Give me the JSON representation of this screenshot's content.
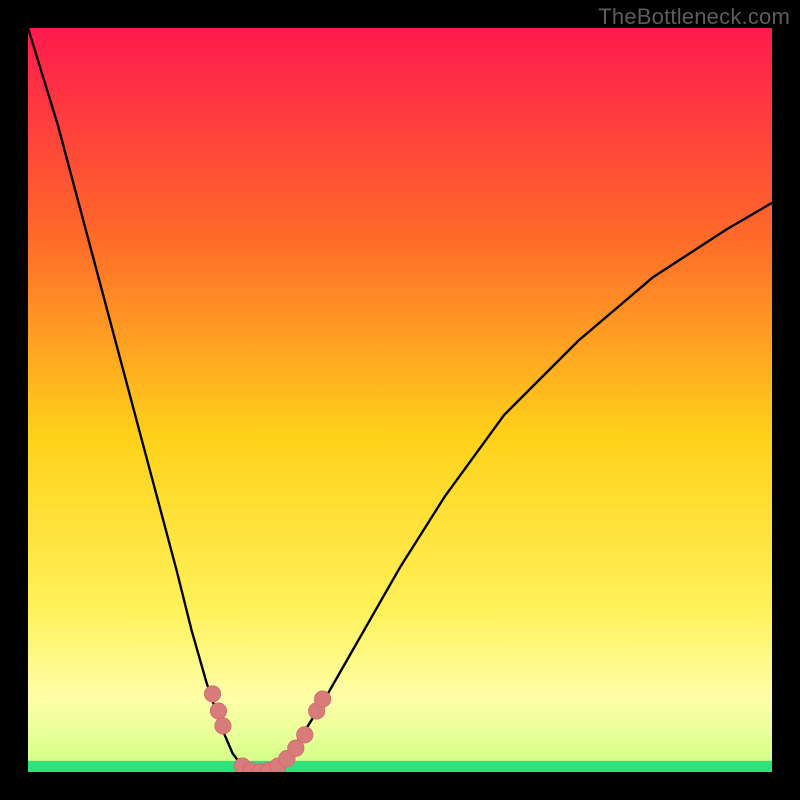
{
  "watermark": "TheBottleneck.com",
  "colors": {
    "frame": "#000000",
    "gradient_top": "#ff1a4d",
    "gradient_mid1": "#ff6a2a",
    "gradient_mid2": "#ffd21a",
    "gradient_mid3": "#fff15a",
    "gradient_pale": "#ffffa8",
    "gradient_green": "#29e07b",
    "curve": "#000000",
    "marker_fill": "#d97b7b",
    "marker_stroke": "#c56a6a"
  },
  "chart_data": {
    "type": "line",
    "title": "",
    "xlabel": "",
    "ylabel": "",
    "xlim": [
      0,
      1000
    ],
    "ylim": [
      0,
      1000
    ],
    "series": [
      {
        "name": "bottleneck-curve",
        "x": [
          0,
          40,
          80,
          120,
          160,
          200,
          220,
          240,
          260,
          275,
          290,
          305,
          320,
          335,
          350,
          370,
          400,
          440,
          500,
          560,
          640,
          740,
          840,
          940,
          1000
        ],
        "y": [
          0,
          130,
          280,
          430,
          580,
          730,
          810,
          880,
          940,
          975,
          995,
          1000,
          998,
          990,
          975,
          948,
          900,
          830,
          725,
          630,
          520,
          420,
          335,
          270,
          235
        ]
      }
    ],
    "markers": [
      {
        "name": "rising-cluster",
        "points": [
          {
            "x": 248,
            "y": 895
          },
          {
            "x": 256,
            "y": 918
          },
          {
            "x": 262,
            "y": 938
          }
        ]
      },
      {
        "name": "bottom-run",
        "points": [
          {
            "x": 288,
            "y": 992
          },
          {
            "x": 300,
            "y": 998
          },
          {
            "x": 312,
            "y": 1000
          },
          {
            "x": 324,
            "y": 998
          },
          {
            "x": 336,
            "y": 992
          },
          {
            "x": 348,
            "y": 982
          },
          {
            "x": 360,
            "y": 968
          },
          {
            "x": 372,
            "y": 950
          }
        ]
      },
      {
        "name": "falling-cluster",
        "points": [
          {
            "x": 388,
            "y": 918
          },
          {
            "x": 396,
            "y": 902
          }
        ]
      }
    ],
    "green_band_y": [
      985,
      1000
    ]
  }
}
